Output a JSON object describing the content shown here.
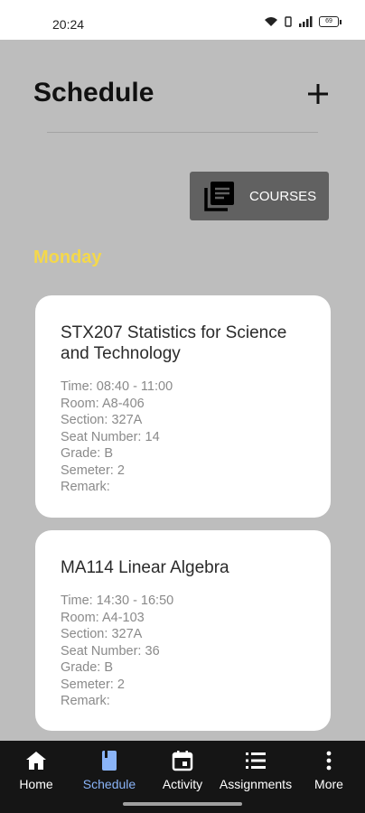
{
  "status": {
    "time": "20:24",
    "battery": "69"
  },
  "header": {
    "title": "Schedule",
    "courses_label": "COURSES"
  },
  "day": "Monday",
  "labels": {
    "time": "Time:",
    "room": "Room:",
    "section": "Section:",
    "seat": "Seat Number:",
    "grade": "Grade:",
    "semester": "Semeter:",
    "remark": "Remark:"
  },
  "classes": [
    {
      "title": "STX207 Statistics for Science and Technology",
      "time": "08:40 - 11:00",
      "room": "A8-406",
      "section": "327A",
      "seat": "14",
      "grade": "B",
      "semester": "2",
      "remark": ""
    },
    {
      "title": "MA114 Linear Algebra",
      "time": "14:30 - 16:50",
      "room": "A4-103",
      "section": "327A",
      "seat": "36",
      "grade": "B",
      "semester": "2",
      "remark": ""
    }
  ],
  "nav": [
    {
      "label": "Home",
      "icon": "home-icon"
    },
    {
      "label": "Schedule",
      "icon": "schedule-icon"
    },
    {
      "label": "Activity",
      "icon": "calendar-icon"
    },
    {
      "label": "Assignments",
      "icon": "list-icon"
    },
    {
      "label": "More",
      "icon": "more-vertical-icon"
    }
  ],
  "colors": {
    "background": "#bdbdbd",
    "day": "#f4d84b",
    "nav_active": "#8ab4f8",
    "nav_bg": "#151515"
  }
}
